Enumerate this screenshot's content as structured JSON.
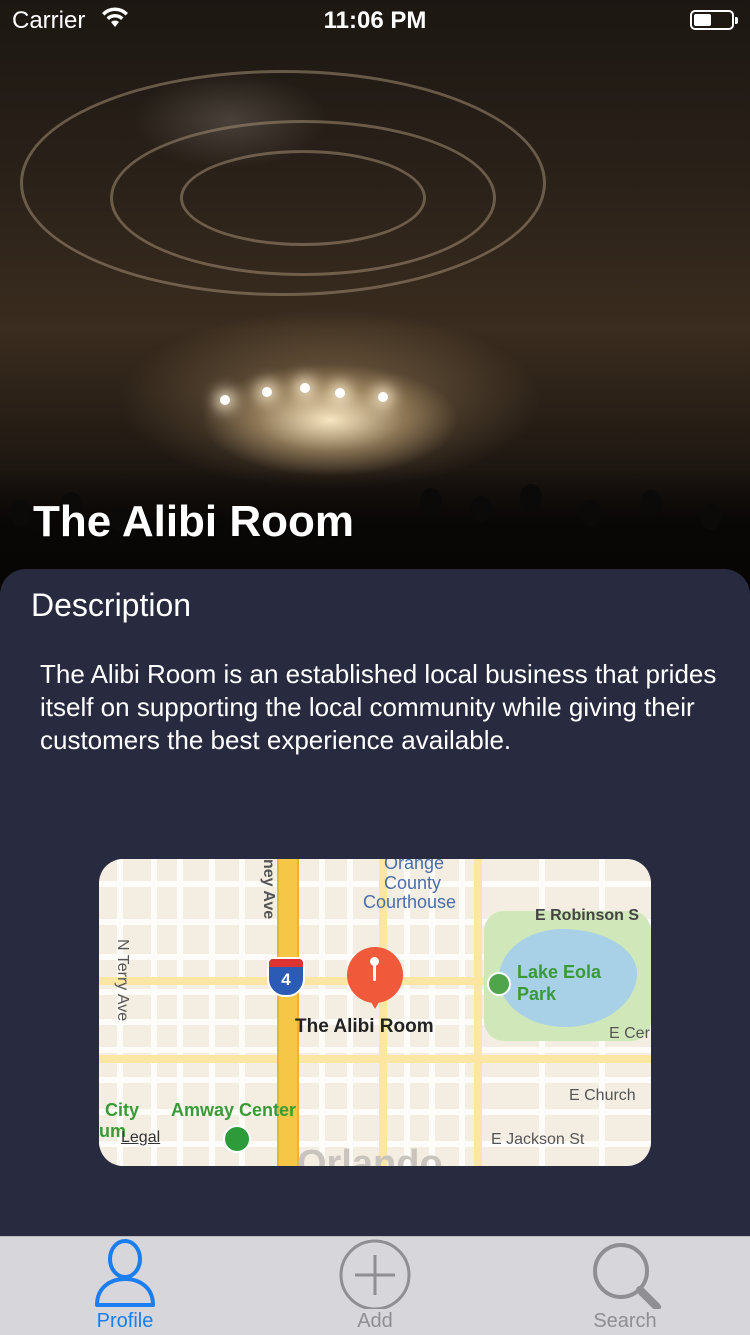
{
  "status_bar": {
    "carrier": "Carrier",
    "time": "11:06 PM",
    "battery_level": 0.4
  },
  "venue": {
    "name": "The Alibi Room"
  },
  "description": {
    "heading": "Description",
    "body": "The Alibi Room is an established local business that prides itself on supporting the local community while giving their customers the best experience available."
  },
  "map": {
    "pin_label": "The Alibi Room",
    "labels": {
      "courthouse_1": "Orange",
      "courthouse_2": "County",
      "courthouse_3": "Courthouse",
      "robinson": "E Robinson S",
      "terry": "N Terry Ave",
      "ney": "ney Ave",
      "lake_1": "Lake Eola",
      "lake_2": "Park",
      "central": "E Cer",
      "church": "E Church",
      "jackson": "E Jackson St",
      "city_1": "City",
      "city_2": "um",
      "amway": "Amway Center",
      "legal": "Legal",
      "orlando": "Orlando",
      "interstate": "4"
    }
  },
  "tabs": [
    {
      "label": "Profile",
      "icon": "person-icon",
      "active": true
    },
    {
      "label": "Add",
      "icon": "plus-circle-icon",
      "active": false
    },
    {
      "label": "Search",
      "icon": "magnifier-icon",
      "active": false
    }
  ],
  "colors": {
    "card_background": "#282b40",
    "tab_active": "#1a7df0",
    "tab_inactive": "#8e8e93",
    "pin": "#f05a3a"
  }
}
